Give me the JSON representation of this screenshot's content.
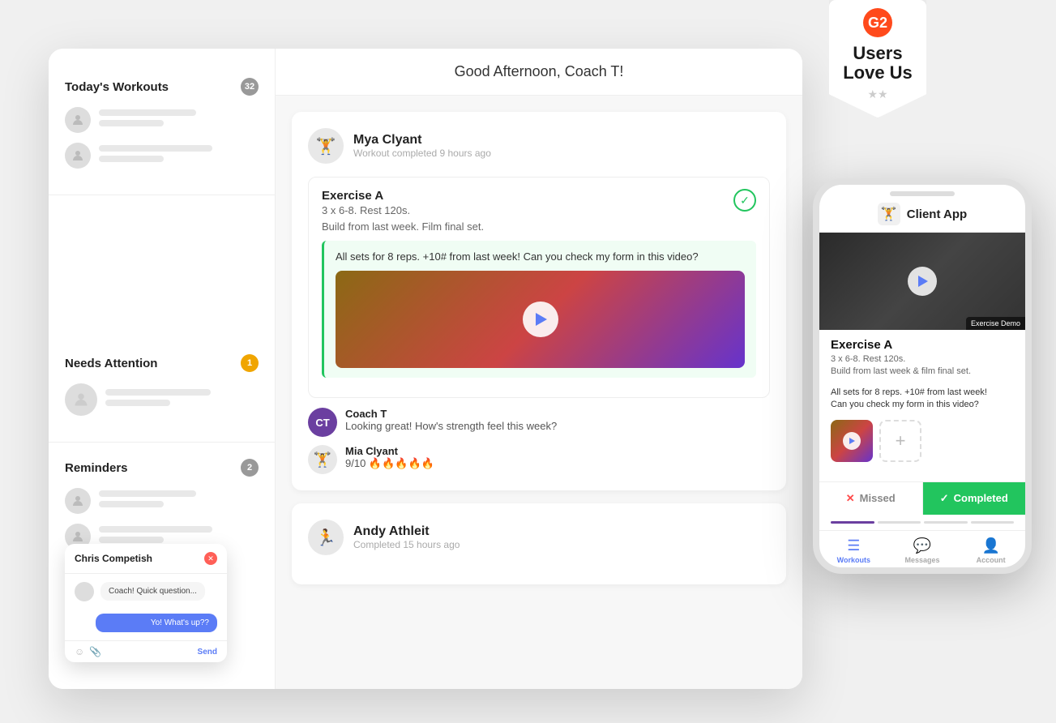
{
  "badge": {
    "logo": "G2",
    "title": "Users Love Us",
    "stars": "★★★★★"
  },
  "sidebar": {
    "todays_workouts_label": "Today's Workouts",
    "todays_workouts_count": "32",
    "needs_attention_label": "Needs Attention",
    "needs_attention_count": "1",
    "reminders_label": "Reminders",
    "reminders_count": "2"
  },
  "chat": {
    "name": "Chris Competish",
    "message_received": "Coach! Quick question...",
    "message_sent": "Yo! What's up??",
    "send_label": "Send"
  },
  "main": {
    "header": "Good Afternoon, Coach T!",
    "user_name": "Mya Clyant",
    "user_time": "Workout completed 9 hours ago",
    "exercise_name": "Exercise A",
    "exercise_details_line1": "3 x 6-8. Rest 120s.",
    "exercise_details_line2": "Build from last week. Film final set.",
    "comment_text": "All sets for 8 reps. +10# from last week! Can you check my form in this video?",
    "coach_name": "Coach T",
    "coach_reply": "Looking great! How's strength feel this week?",
    "client_name": "Mia Clyant",
    "client_reply": "9/10 🔥🔥🔥🔥🔥",
    "second_user_name": "Andy Athleit",
    "second_user_time": "Completed 15 hours ago"
  },
  "phone": {
    "header_title": "Client App",
    "video_overlay": "Exercise Demo",
    "exercise_name": "Exercise A",
    "exercise_detail": "3 x 6-8. Rest 120s.\nBuild from last week & film final set.",
    "comment": "All sets for 8 reps. +10# from last week!\nCan you check my form in this video?",
    "missed_label": "Missed",
    "completed_label": "Completed",
    "nav_workouts": "Workouts",
    "nav_messages": "Messages",
    "nav_account": "Account"
  }
}
